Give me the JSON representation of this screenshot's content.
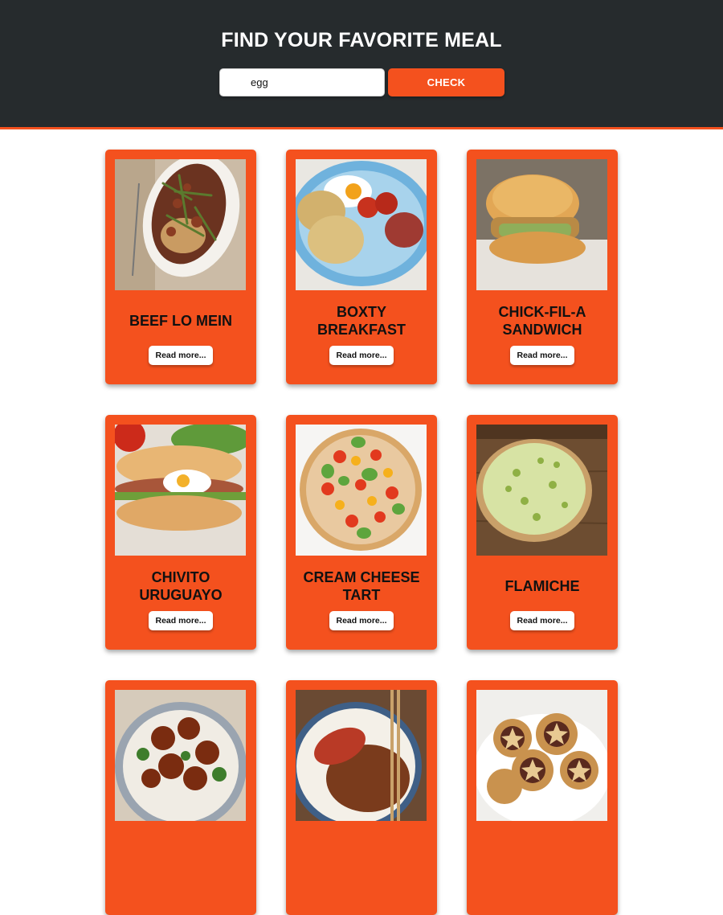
{
  "header": {
    "title": "FIND YOUR FAVORITE MEAL",
    "search_value": "egg",
    "check_label": "CHECK"
  },
  "colors": {
    "accent": "#f4511e",
    "header_bg": "#262b2d"
  },
  "meals": [
    {
      "title": "BEEF LO MEIN",
      "button": "Read more...",
      "image": "beef-lo-mein-photo"
    },
    {
      "title": "BOXTY BREAKFAST",
      "button": "Read more...",
      "image": "boxty-breakfast-photo"
    },
    {
      "title": "CHICK-FIL-A SANDWICH",
      "button": "Read more...",
      "image": "chick-fil-a-sandwich-photo"
    },
    {
      "title": "CHIVITO URUGUAYO",
      "button": "Read more...",
      "image": "chivito-uruguayo-photo"
    },
    {
      "title": "CREAM CHEESE TART",
      "button": "Read more...",
      "image": "cream-cheese-tart-photo"
    },
    {
      "title": "FLAMICHE",
      "button": "Read more...",
      "image": "flamiche-photo"
    },
    {
      "title": "",
      "button": "",
      "image": "glazed-chicken-rice-bowl-photo"
    },
    {
      "title": "",
      "button": "",
      "image": "katsu-curry-photo"
    },
    {
      "title": "",
      "button": "",
      "image": "mince-pies-photo"
    }
  ]
}
